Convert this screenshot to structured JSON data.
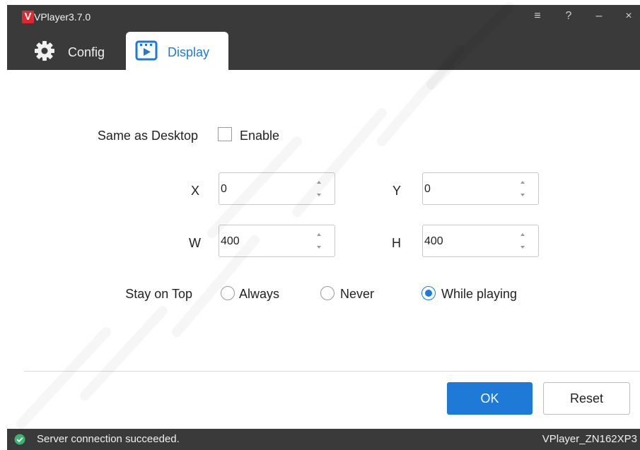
{
  "app": {
    "title": "VPlayer3.7.0",
    "logo_letter": "V"
  },
  "colors": {
    "accent": "#1e7ad6",
    "bar": "#3a3a3a",
    "status_ok": "#3cb371",
    "logo": "#e3262d"
  },
  "window_controls": {
    "menu": "≡",
    "help": "?",
    "minimize": "–",
    "close": "×"
  },
  "tabs": [
    {
      "label": "Config",
      "icon": "gear-icon",
      "active": false
    },
    {
      "label": "Display",
      "icon": "display-icon",
      "active": true
    }
  ],
  "display": {
    "same_as_desktop": {
      "label": "Same as Desktop",
      "checkbox_label": "Enable",
      "checked": false
    },
    "x": {
      "label": "X",
      "value": "0"
    },
    "y": {
      "label": "Y",
      "value": "0"
    },
    "w": {
      "label": "W",
      "value": "400"
    },
    "h": {
      "label": "H",
      "value": "400"
    },
    "stay_on_top": {
      "label": "Stay on Top",
      "options": [
        "Always",
        "Never",
        "While playing"
      ],
      "selected": "While playing"
    }
  },
  "buttons": {
    "ok": "OK",
    "reset": "Reset"
  },
  "status": {
    "message": "Server connection succeeded.",
    "device": "VPlayer_ZN162XP3",
    "icon": "check-circle-icon"
  }
}
